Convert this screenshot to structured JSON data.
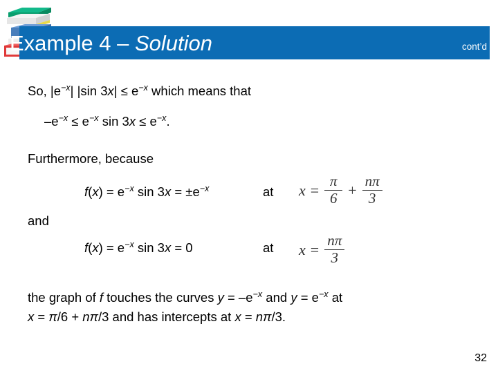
{
  "slide": {
    "page_number": "32",
    "title": {
      "prefix": "Example 4 ",
      "dash": "– ",
      "italic_part": "Solution",
      "contd_label": "cont’d",
      "banner_color": "#0c6cb4",
      "title_color": "#ffffff"
    },
    "decoration": {
      "icon_name": "stack-of-books-icon",
      "book_colors": [
        "#0aa06e",
        "#e8e8e8",
        "#ffffff",
        "#4a7ebb",
        "#d8d8d8",
        "#e03a3a",
        "#f2f2f2"
      ]
    },
    "body": {
      "line_so": {
        "pre": "So, |e",
        "sup1": "−x",
        "mid1": "| |sin 3",
        "var1": "x",
        "mid2": "| ≤ e",
        "sup2": "−x",
        "post": " which means that"
      },
      "line_inequality": {
        "pre": "–e",
        "sup1": "−x",
        "mid1": " ≤ e",
        "sup2": "−x",
        "mid2": " sin 3",
        "var1": "x",
        "mid3": " ≤ e",
        "sup3": "−x",
        "post": "."
      },
      "line_furthermore": "Furthermore, because",
      "equation_1": {
        "f": "f",
        "open": "(",
        "var": "x",
        "close": ") = e",
        "sup1": "−x",
        "mid": " sin 3",
        "var2": "x",
        "tail": " = ±e",
        "sup2": "−x",
        "at_label": "at"
      },
      "line_and": "and",
      "equation_2": {
        "f": "f",
        "open": "(",
        "var": "x",
        "close": ") = e",
        "sup1": "−x",
        "mid": " sin 3",
        "var2": "x",
        "tail": " = 0",
        "at_label": "at"
      },
      "paragraph_line_1": {
        "pre": "the graph of ",
        "var_f": "f",
        "mid1": " touches the curves ",
        "var_y1": "y",
        "mid2": " = –e",
        "sup1": "−x",
        "mid3": " and ",
        "var_y2": "y",
        "mid4": " = e",
        "sup2": "−x",
        "post": " at"
      },
      "paragraph_line_2": {
        "var_x1": "x",
        "mid1": " = ",
        "pi1": "π",
        "mid2": "/6 + ",
        "n1": "n",
        "pi2": "π",
        "mid3": "/3 and has intercepts at ",
        "var_x2": "x",
        "mid4": " = ",
        "n2": "n",
        "pi3": "π",
        "mid5": "/3."
      }
    },
    "math_images": {
      "image_1": {
        "name": "equation-x-equals-pi-over-6-plus-n-pi-over-3",
        "lhs_var": "x",
        "equals": "=",
        "frac1_num": "π",
        "frac1_den": "6",
        "operator": "+",
        "frac2_num": "nπ",
        "frac2_den": "3"
      },
      "image_2": {
        "name": "equation-x-equals-n-pi-over-3",
        "lhs_var": "x",
        "equals": "=",
        "frac_num": "nπ",
        "frac_den": "3"
      }
    }
  }
}
